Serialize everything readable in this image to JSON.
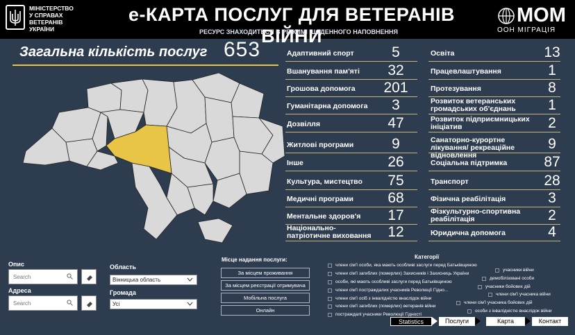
{
  "header": {
    "ministry": [
      "МІНІСТЕРСТВО",
      "У СПРАВАХ",
      "ВЕТЕРАНІВ",
      "УКРАЇНИ"
    ],
    "title": "е-КАРТА ПОСЛУГ ДЛЯ ВЕТЕРАНІВ ВІЙНИ",
    "subtitle": "РЕСУРС ЗНАХОДИТЬСЯ В РЕЖИМІ ЩОДЕННОГО НАПОВНЕННЯ",
    "iom_name": "МОМ",
    "iom_sub": "ООН МІГРАЦІЯ"
  },
  "total": {
    "label": "Загальна кількість послуг",
    "value": "653"
  },
  "stats_left": [
    {
      "label": "Адаптивний спорт",
      "value": "5"
    },
    {
      "label": "Вшанування пам'яті",
      "value": "32"
    },
    {
      "label": "Грошова допомога",
      "value": "201"
    },
    {
      "label": "Гуманітарна допомога",
      "value": "3"
    },
    {
      "label": "Дозвілля",
      "value": "47"
    },
    {
      "label": "Житлові програми",
      "value": "9"
    },
    {
      "label": "Інше",
      "value": "26"
    },
    {
      "label": "Культура, мистецтво",
      "value": "75"
    },
    {
      "label": "Медичні програми",
      "value": "68"
    },
    {
      "label": "Ментальне здоров'я",
      "value": "17"
    },
    {
      "label": "Національно-патріотичне виховання",
      "value": "12"
    }
  ],
  "stats_right": [
    {
      "label": "Освіта",
      "value": "13"
    },
    {
      "label": "Працевлаштування",
      "value": "1"
    },
    {
      "label": "Протезування",
      "value": "8"
    },
    {
      "label": "Розвиток ветеранських громадських об'єднань",
      "value": "1"
    },
    {
      "label": "Розвиток підприємницьких ініціатив",
      "value": "2"
    },
    {
      "label": "Санаторно-курортне лікування/ рекреаційне відновлення",
      "value": "9"
    },
    {
      "label": "Соціальна підтримка",
      "value": "87"
    },
    {
      "label": "Транспорт",
      "value": "28"
    },
    {
      "label": "Фізична реабілітація",
      "value": "3"
    },
    {
      "label": "Фізкультурно-спортивна реабілітація",
      "value": "2"
    },
    {
      "label": "Юридична допомога",
      "value": "4"
    }
  ],
  "filters": {
    "opys_label": "Опис",
    "opys_placeholder": "Search",
    "adresa_label": "Адреса",
    "adresa_placeholder": "Search",
    "oblast_label": "Область",
    "oblast_value": "Вінницька область",
    "hromada_label": "Громада",
    "hromada_value": "Усі"
  },
  "place": {
    "label": "Місце надання послуги:",
    "buttons": [
      "За місцем проживання",
      "За місцем реєстрації отримувача",
      "Мобільна послуга",
      "Онлайн"
    ]
  },
  "categories": {
    "title": "Категорії",
    "items": [
      "члени сім'ї особи, яка мають особливі заслуги перед Батьківщиною",
      "члени сім'ї загиблих (померлих) Захисників і Захисниць України",
      "особи, які мають особливі заслуги перед Батьківщиною",
      "члени сім'ї постраждалих учасників Революції Гідно...",
      "члени сім'ї осіб з інвалідністю внаслідок війни",
      "члени сім'ї загиблих (померлих) ветеранів війни",
      "постраждалі учасники Революції Гідності",
      "учасники війни",
      "демобілізовані особи",
      "учасники бойових дій",
      "члени сім'ї учасника війни",
      "члени сім'ї учасника бойових дій",
      "особи з інвалідністю внаслідок війни"
    ]
  },
  "nav": [
    "Statistics",
    "Послуги",
    "Карта",
    "Контакт"
  ],
  "colors": {
    "highlight": "#e8c547",
    "background": "#2e3c4f",
    "region": "#d9d9d9"
  }
}
